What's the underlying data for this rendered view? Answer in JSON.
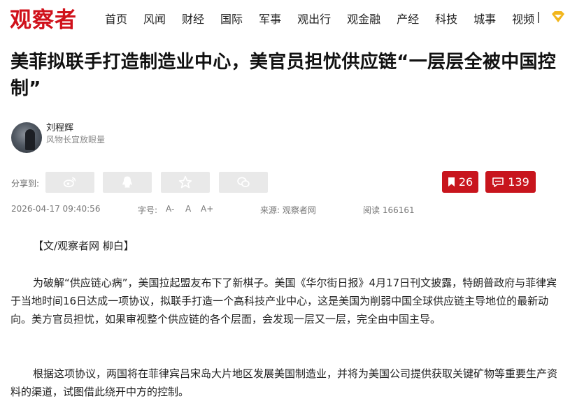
{
  "header": {
    "logo": "观察者",
    "nav": [
      "首页",
      "风闻",
      "财经",
      "国际",
      "军事",
      "观出行",
      "观金融",
      "产经",
      "科技",
      "城事",
      "视频"
    ],
    "separator": "|",
    "vip_icon": "vip-diamond-icon"
  },
  "article": {
    "title": "美菲拟联手打造制造业中心，美官员担忧供应链“一层层全被中国控制”",
    "author": {
      "name": "刘程辉",
      "bio": "风物长宜放眼量"
    },
    "share": {
      "label": "分享到:",
      "icons": [
        "weibo-icon",
        "qq-icon",
        "qzone-star-icon",
        "wechat-icon"
      ]
    },
    "bookmark_count": "26",
    "comment_count": "139",
    "meta": {
      "datetime": "2026-04-17 09:40:56",
      "font_label": "字号:",
      "font_sizes": [
        "A-",
        "A",
        "A+"
      ],
      "source": "来源:  观察者网",
      "reads": "阅读 166161"
    },
    "byline": "【文/观察者网 柳白】",
    "paragraphs": [
      "为破解“供应链心病”，美国拉起盟友布下了新棋子。美国《华尔街日报》4月17日刊文披露，特朗普政府与菲律宾于当地时间16日达成一项协议，拟联手打造一个高科技产业中心，这是美国为削弱中国全球供应链主导地位的最新动向。美方官员担忧，如果审视整个供应链的各个层面，会发现一层又一层，完全由中国主导。",
      "根据这项协议，两国将在菲律宾吕宋岛大片地区发展美国制造业，并将为美国公司提供获取关键矿物等重要生产资料的渠道，试图借此绕开中方的控制。"
    ]
  },
  "colors": {
    "brand_red": "#d0111b",
    "button_red": "#c8151d",
    "share_gray": "#e9e9e9"
  }
}
